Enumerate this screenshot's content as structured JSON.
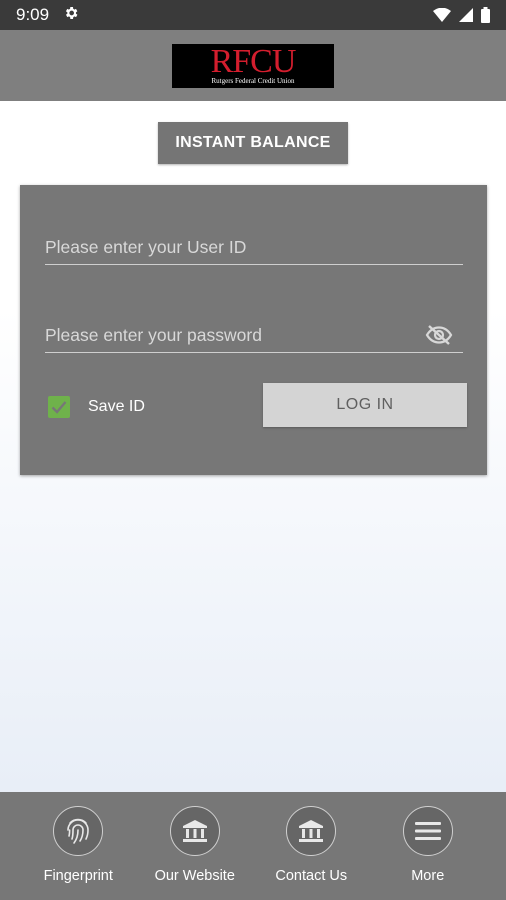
{
  "status_bar": {
    "time": "9:09"
  },
  "header": {
    "logo_text": "RFCU",
    "logo_subtext": "Rutgers Federal Credit Union"
  },
  "main": {
    "instant_balance_label": "INSTANT BALANCE",
    "login": {
      "userid_placeholder": "Please enter your User ID",
      "password_placeholder": "Please enter your password",
      "save_id_label": "Save ID",
      "save_id_checked": true,
      "login_button_label": "LOG IN"
    }
  },
  "bottom_nav": {
    "items": [
      {
        "label": "Fingerprint",
        "icon": "fingerprint-icon"
      },
      {
        "label": "Our Website",
        "icon": "bank-icon"
      },
      {
        "label": "Contact Us",
        "icon": "bank-icon"
      },
      {
        "label": "More",
        "icon": "menu-icon"
      }
    ]
  },
  "colors": {
    "header_bg": "#7f7f7f",
    "card_bg": "#777777",
    "logo_red": "#d41e2e",
    "checkbox_green": "#6fb24b"
  }
}
